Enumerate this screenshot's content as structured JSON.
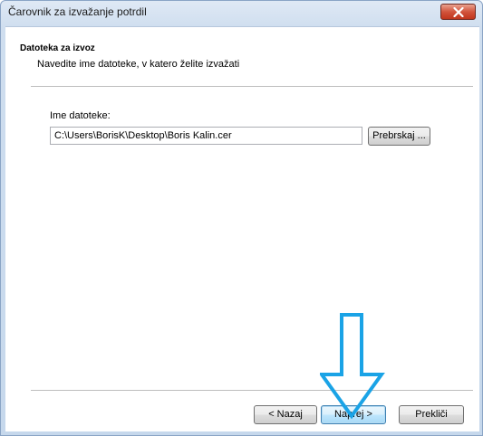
{
  "window": {
    "title": "Čarovnik za izvažanje potrdil"
  },
  "header": {
    "title": "Datoteka za izvoz",
    "description": "Navedite ime datoteke, v katero želite izvažati"
  },
  "form": {
    "filename_label": "Ime datoteke:",
    "filename_value": "C:\\Users\\BorisK\\Desktop\\Boris Kalin.cer",
    "browse_label": "Prebrskaj ..."
  },
  "footer": {
    "back_label": "< Nazaj",
    "next_label": "Naprej >",
    "cancel_label": "Prekliči"
  },
  "icons": {
    "close": "close-x-icon",
    "annotation": "down-arrow-annotation"
  },
  "colors": {
    "arrow_outline": "#1aa3e6",
    "close_button": "#c7422a",
    "default_button_border": "#3c7fb1"
  }
}
